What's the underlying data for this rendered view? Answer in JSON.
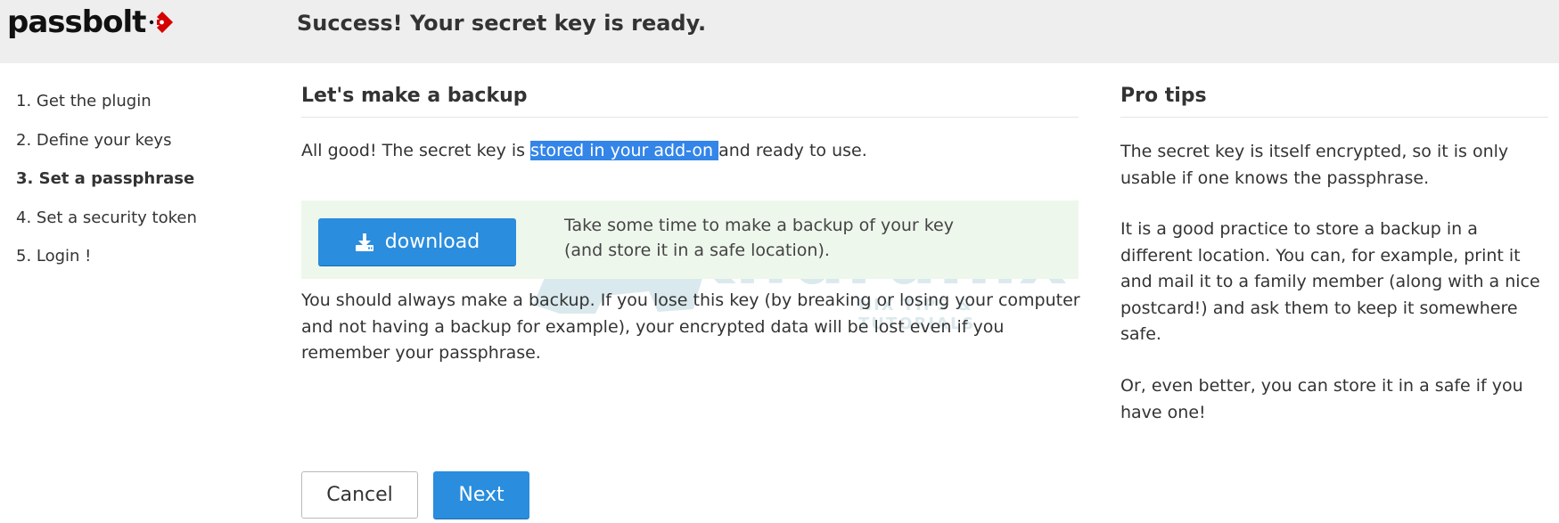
{
  "brand": {
    "logo_text": "passbolt",
    "logo_color": "#d40101"
  },
  "header": {
    "title": "Success! Your secret key is ready."
  },
  "steps": [
    {
      "label": "1. Get the plugin",
      "current": false
    },
    {
      "label": "2. Define your keys",
      "current": false
    },
    {
      "label": "3. Set a passphrase",
      "current": true
    },
    {
      "label": "4. Set a security token",
      "current": false
    },
    {
      "label": "5. Login !",
      "current": false
    }
  ],
  "main": {
    "title": "Let's make a backup",
    "intro_before": "All good! The secret key is ",
    "intro_highlight": "stored in your add-on ",
    "intro_after": "and ready to use.",
    "download_label": "download",
    "download_hint_line1": "Take some time to make a backup of your key",
    "download_hint_line2": "(and store it in a safe location).",
    "warning": "You should always make a backup. If you lose this key (by breaking or losing your computer and not having a backup for example), your encrypted data will be lost even if you remember your passphrase."
  },
  "tips": {
    "title": "Pro tips",
    "items": [
      "The secret key is itself encrypted, so it is only usable if one knows the passphrase.",
      "It is a good practice to store a backup in a different location. You can, for example, print it and mail it to a family member (along with a nice postcard!) and ask them to keep it somewhere safe.",
      "Or, even better, you can store it in a safe if you have one!"
    ]
  },
  "buttons": {
    "cancel": "Cancel",
    "next": "Next"
  },
  "watermark": {
    "text": "Kifarunix",
    "subtext": "NIX TIPS & TUTORIALS"
  },
  "colors": {
    "primary": "#2a8ddd",
    "highlight": "#3385e8",
    "download_box_bg": "#eef7ec",
    "header_bg": "#eeeeee"
  },
  "icons": {
    "download": "download-icon",
    "logo_mark": "passbolt-arrow-icon"
  }
}
